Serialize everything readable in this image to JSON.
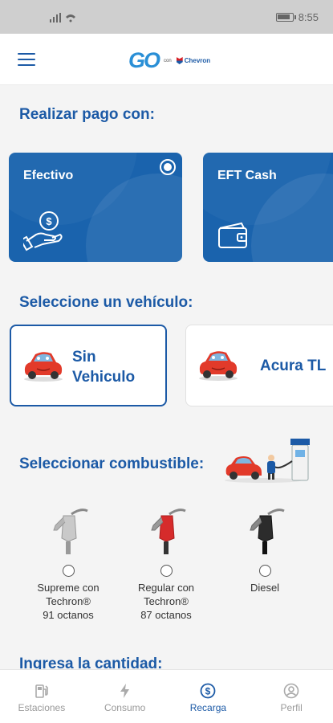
{
  "status_bar": {
    "time": "8:55"
  },
  "header": {
    "logo_text": "GO",
    "logo_small": "con",
    "logo_brand": "Chevron"
  },
  "payment": {
    "title": "Realizar pago con:",
    "options": [
      {
        "label": "Efectivo",
        "selected": true,
        "icon": "cash-hand-icon"
      },
      {
        "label": "EFT Cash",
        "selected": false,
        "icon": "wallet-icon"
      }
    ]
  },
  "vehicle": {
    "title": "Seleccione un vehículo:",
    "options": [
      {
        "line1": "Sin",
        "line2": "Vehiculo",
        "selected": true
      },
      {
        "line1": "Acura TL",
        "selected": false
      }
    ]
  },
  "fuel": {
    "title": "Seleccionar combustible:",
    "options": [
      {
        "line1": "Supreme con",
        "line2": "Techron®",
        "line3": "91 octanos",
        "color": "#c9c9c9"
      },
      {
        "line1": "Regular con",
        "line2": "Techron®",
        "line3": "87 octanos",
        "color": "#d62b2b"
      },
      {
        "line1": "Diesel",
        "color": "#2c2c2c"
      }
    ]
  },
  "amount": {
    "title": "Ingresa la cantidad:"
  },
  "nav": {
    "items": [
      {
        "label": "Estaciones",
        "icon": "gas-station-icon"
      },
      {
        "label": "Consumo",
        "icon": "lightning-icon"
      },
      {
        "label": "Recarga",
        "icon": "dollar-circle-icon",
        "active": true
      },
      {
        "label": "Perfil",
        "icon": "person-icon"
      }
    ]
  },
  "colors": {
    "primary": "#1c5aa6",
    "card": "#1a63ad",
    "background": "#f4f4f4"
  }
}
